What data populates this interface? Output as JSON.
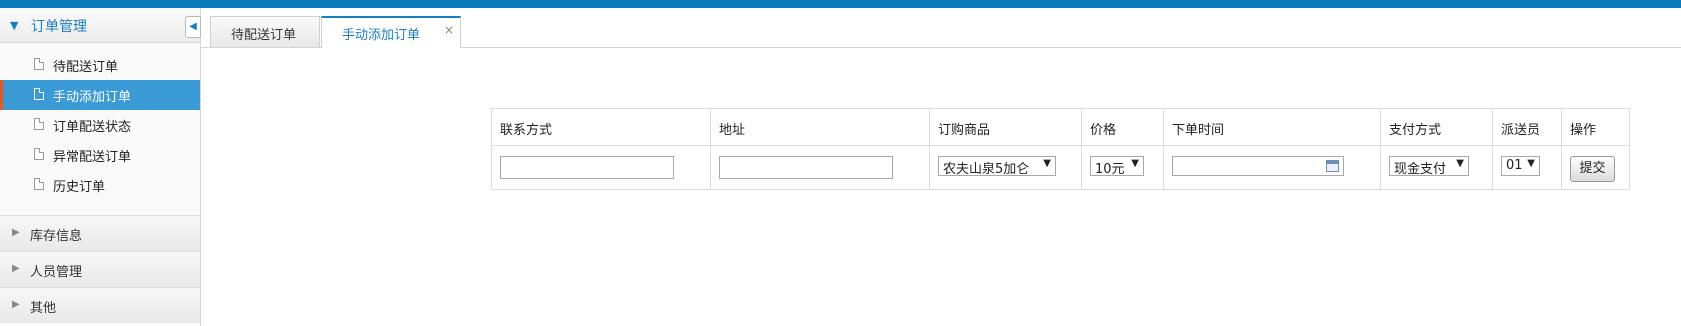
{
  "sidebar": {
    "header": {
      "title": "订单管理"
    },
    "items": [
      {
        "label": "待配送订单"
      },
      {
        "label": "手动添加订单"
      },
      {
        "label": "订单配送状态"
      },
      {
        "label": "异常配送订单"
      },
      {
        "label": "历史订单"
      }
    ],
    "groups": [
      {
        "label": "库存信息"
      },
      {
        "label": "人员管理"
      },
      {
        "label": "其他"
      }
    ]
  },
  "tabs": [
    {
      "label": "待配送订单"
    },
    {
      "label": "手动添加订单",
      "close": "×"
    }
  ],
  "table": {
    "headers": [
      "联系方式",
      "地址",
      "订购商品",
      "价格",
      "下单时间",
      "支付方式",
      "派送员",
      "操作"
    ],
    "row": {
      "contact_value": "",
      "address_value": "",
      "product_selected": "农夫山泉5加仑",
      "price_selected": "10元",
      "order_time_value": "",
      "payment_selected": "现金支付",
      "courier_selected": "01",
      "submit_label": "提交"
    }
  },
  "colors": {
    "accent": "#0a7bbd",
    "active_item": "#3a9ad6",
    "active_marker": "#e05a2a"
  }
}
